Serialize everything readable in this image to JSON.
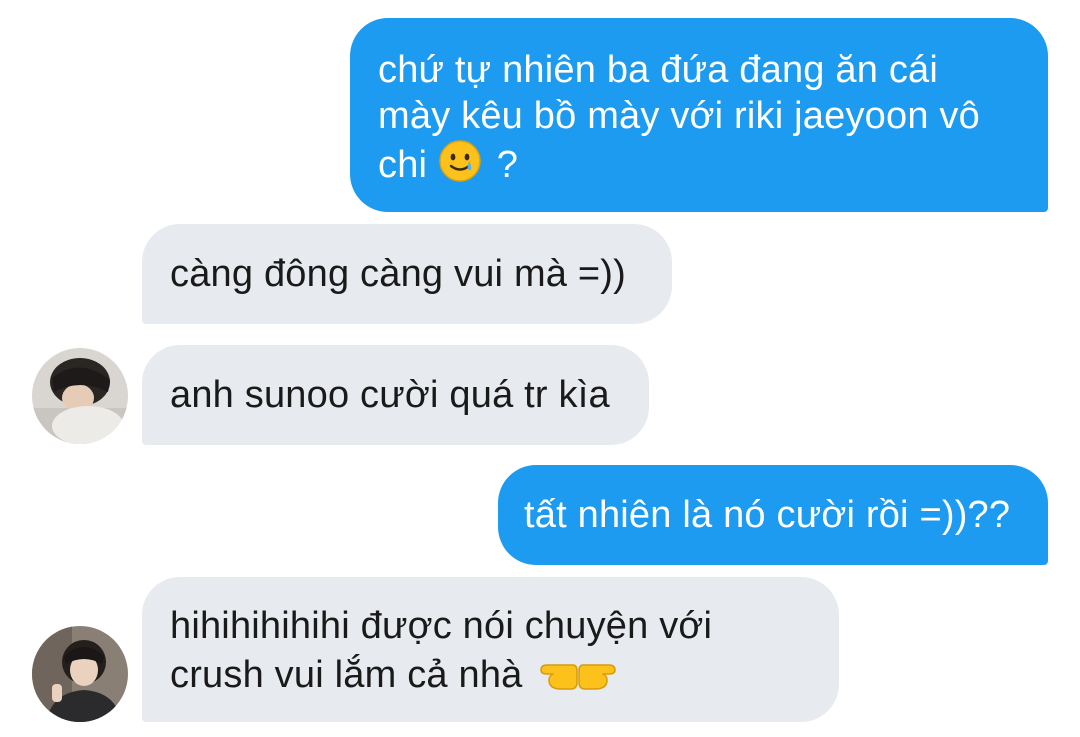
{
  "messages": [
    {
      "direction": "outgoing",
      "lines": [
        "chứ tự nhiên ba đứa đang ăn cái",
        "mày kêu bồ mày với riki jaeyoon vô",
        "chi",
        "?"
      ],
      "emoji": "smiling-face-with-tear-icon"
    },
    {
      "direction": "incoming",
      "lines": [
        "càng đông càng vui mà =))"
      ]
    },
    {
      "direction": "incoming",
      "lines": [
        "anh sunoo cười quá tr kìa"
      ]
    },
    {
      "direction": "outgoing",
      "lines": [
        "tất nhiên là nó cười rồi =))??"
      ]
    },
    {
      "direction": "incoming",
      "lines": [
        "hihihihihihi được nói chuyện với",
        "crush vui lắm cả nhà"
      ],
      "emoji": "pointing-fingers-icon"
    }
  ],
  "colors": {
    "outgoing_bubble": "#1d9bf0",
    "incoming_bubble": "#e7eaee",
    "outgoing_text": "#ffffff",
    "incoming_text": "#1a1a1a"
  }
}
